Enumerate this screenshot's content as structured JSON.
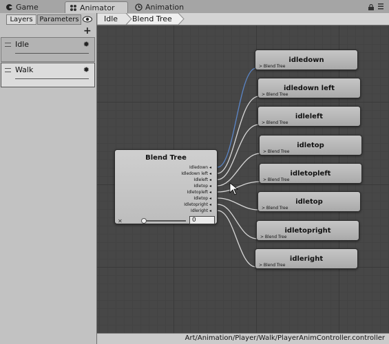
{
  "tabs": [
    {
      "label": "Game",
      "icon": "game-icon"
    },
    {
      "label": "Animator",
      "icon": "animator-icon",
      "active": true
    },
    {
      "label": "Animation",
      "icon": "animation-icon"
    }
  ],
  "left_panel": {
    "tabs": [
      {
        "label": "Layers",
        "active": true
      },
      {
        "label": "Parameters"
      }
    ],
    "add_label": "+",
    "layers": [
      {
        "name": "Idle"
      },
      {
        "name": "Walk"
      }
    ]
  },
  "breadcrumb": [
    "Idle",
    "Blend Tree"
  ],
  "blend_tree": {
    "title": "Blend Tree",
    "parameters": [
      "Idledown",
      "Idledown left",
      "Idleleft",
      "Idletop",
      "Idletopleft",
      "Idletop",
      "Idletopright",
      "Idleright"
    ],
    "value": "0"
  },
  "motion_nodes": [
    {
      "title": "idledown",
      "port": "Blend Tree"
    },
    {
      "title": "idledown left",
      "port": "Blend Tree"
    },
    {
      "title": "idleleft",
      "port": "Blend Tree"
    },
    {
      "title": "idletop",
      "port": "Blend Tree"
    },
    {
      "title": "idletopleft",
      "port": "Blend Tree"
    },
    {
      "title": "idletop",
      "port": "Blend Tree"
    },
    {
      "title": "idletopright",
      "port": "Blend Tree"
    },
    {
      "title": "idleright",
      "port": "Blend Tree"
    }
  ],
  "status": {
    "path": "Art/Animation/Player/Walk/PlayerAnimController.controller"
  },
  "colors": {
    "highlight_wire": "#5b86c8",
    "wire": "#d8d8d8",
    "graph_bg": "#474747"
  }
}
